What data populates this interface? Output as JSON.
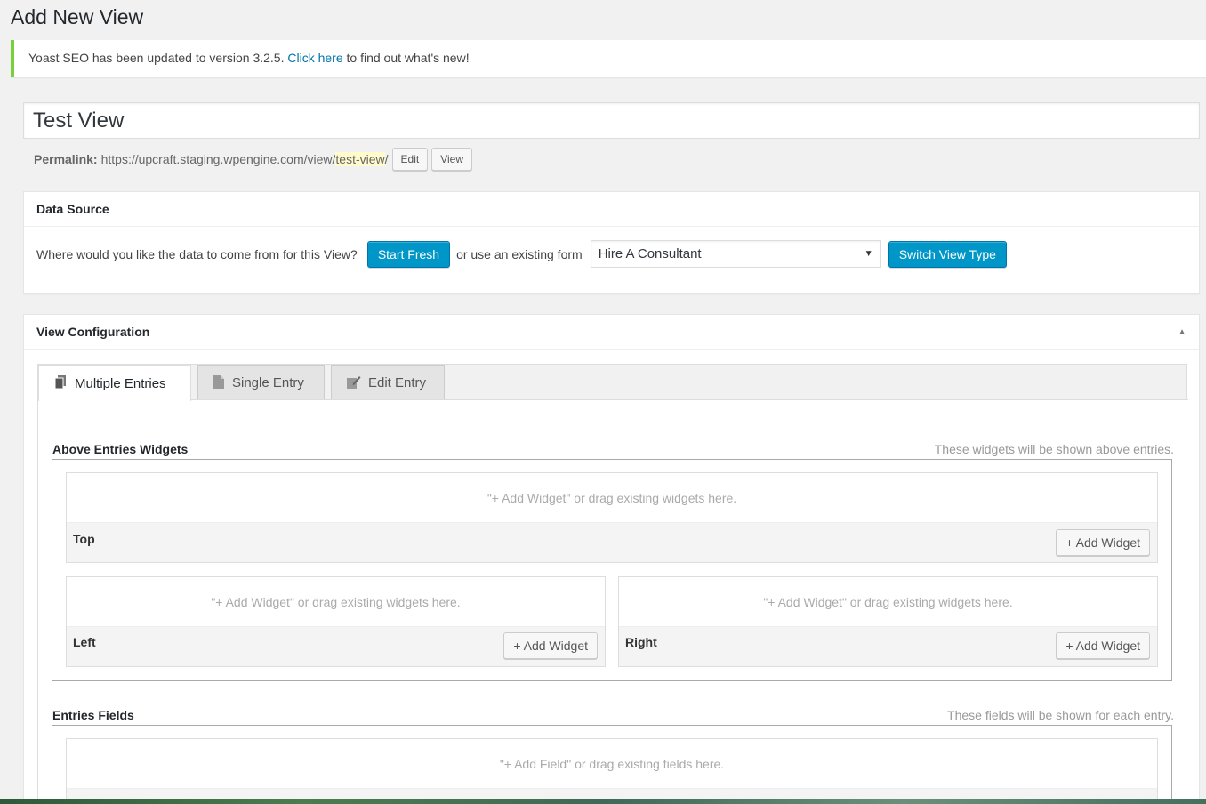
{
  "page": {
    "title": "Add New View"
  },
  "notice": {
    "text_before": "Yoast SEO has been updated to version 3.2.5. ",
    "link": "Click here",
    "text_after": " to find out what's new!"
  },
  "post": {
    "title_value": "Test View",
    "permalink_label": "Permalink:",
    "permalink_base": "https://upcraft.staging.wpengine.com/view/",
    "permalink_slug": "test-view",
    "permalink_tail": "/",
    "edit_label": "Edit",
    "view_label": "View"
  },
  "data_source": {
    "title": "Data Source",
    "question": "Where would you like the data to come from for this View?",
    "start_fresh": "Start Fresh",
    "or_text": "or use an existing form",
    "selected_form": "Hire A Consultant",
    "switch_button": "Switch View Type"
  },
  "view_config": {
    "title": "View Configuration",
    "tabs": [
      {
        "label": "Multiple Entries"
      },
      {
        "label": "Single Entry"
      },
      {
        "label": "Edit Entry"
      }
    ],
    "above_widgets": {
      "heading": "Above Entries Widgets",
      "desc": "These widgets will be shown above entries.",
      "hint": "\"+ Add Widget\" or drag existing widgets here.",
      "top_label": "Top",
      "left_label": "Left",
      "right_label": "Right",
      "add_label": "+ Add Widget"
    },
    "entries_fields": {
      "heading": "Entries Fields",
      "desc": "These fields will be shown for each entry.",
      "hint": "\"+ Add Field\" or drag existing fields here."
    }
  }
}
